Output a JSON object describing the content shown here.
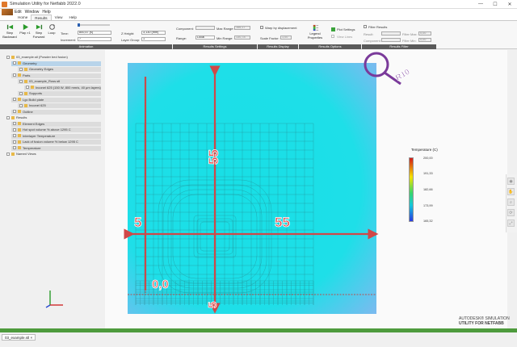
{
  "window": {
    "title": "Simulation Utility for Netfabb 2022.0",
    "controls": [
      "—",
      "☐",
      "✕"
    ]
  },
  "menu": [
    "Edit",
    "Window",
    "Help"
  ],
  "ribbon_tabs": [
    {
      "label": "Home",
      "active": false
    },
    {
      "label": "Results",
      "active": true
    },
    {
      "label": "View",
      "active": false
    },
    {
      "label": "Help",
      "active": false
    }
  ],
  "animation": {
    "step_backward": "Step Backward",
    "play": "Play ×1",
    "step_forward": "Step Forward",
    "loop": "Loop",
    "time_label": "Time:",
    "time_value": "800,57 (s)",
    "increment_label": "Increment:",
    "increment_value": "7",
    "z_height_label": "Z Height:",
    "z_height_value": "3,130 (mm)",
    "layer_group_label": "Layer Group:",
    "layer_group_value": "1",
    "section": "Animation"
  },
  "results_settings": {
    "component_label": "Component:",
    "max_range_label": "Max Range:",
    "max_range_value": "166,17",
    "range_label": "Range:",
    "range_value": "Local",
    "min_range_label": "Min Range:",
    "min_range_value": "130,78",
    "section": "Results Settings"
  },
  "results_display": {
    "warp": "Warp by displacement",
    "scale_label": "Scale Factor:",
    "scale_value": "1,00",
    "section": "Results Display"
  },
  "results_options": {
    "legend": "Legend Properties",
    "plot": "Plot Settings",
    "view_lines": "View Lines",
    "section": "Results Options"
  },
  "results_filter": {
    "filter": "Filter Results",
    "result_label": "Result:",
    "component_label": "Component:",
    "filter_max_label": "Filter Max:",
    "filter_max_value": "0,00",
    "filter_min_label": "Filter Min:",
    "filter_min_value": "0,00",
    "section": "Results Filter"
  },
  "tree": [
    {
      "label": "03_example.stl (Powder bed fusion)",
      "indent": 0,
      "style": "plain"
    },
    {
      "label": "Geometry",
      "indent": 1,
      "style": "sel"
    },
    {
      "label": "Geometry Edges",
      "indent": 2,
      "style": "bar"
    },
    {
      "label": "Parts",
      "indent": 1,
      "style": "bar"
    },
    {
      "label": "03_example_Ross.stl",
      "indent": 2,
      "style": "bar"
    },
    {
      "label": "Inconel 625 (150 W, 800 mm/s, 40 μm layers)",
      "indent": 3,
      "style": "bar"
    },
    {
      "label": "Supports",
      "indent": 2,
      "style": "bar"
    },
    {
      "label": "Lgc Build plate",
      "indent": 1,
      "style": "bar"
    },
    {
      "label": "Inconel 625",
      "indent": 2,
      "style": "bar"
    },
    {
      "label": "Outline",
      "indent": 1,
      "style": "bar"
    },
    {
      "label": "Results",
      "indent": 0,
      "style": "plain"
    },
    {
      "label": "Element Edges",
      "indent": 1,
      "style": "bar"
    },
    {
      "label": "Hot spot volume % above 1295 C",
      "indent": 1,
      "style": "bar"
    },
    {
      "label": "Interlayer Temperature",
      "indent": 1,
      "style": "bar"
    },
    {
      "label": "Lack of fusion volume % below 1295 C",
      "indent": 1,
      "style": "bar"
    },
    {
      "label": "Temperature",
      "indent": 1,
      "style": "bar"
    },
    {
      "label": "Named Views",
      "indent": 0,
      "style": "plain"
    }
  ],
  "annotations": {
    "r10": "R10",
    "v55": "55",
    "h55": "55",
    "left5": "5",
    "origin": "0,0",
    "bottom5": "5"
  },
  "legend": {
    "title": "Temperature (C)",
    "ticks": [
      "200,00",
      "191,33",
      "182,66",
      "173,99",
      "165,32"
    ],
    "colors": {
      "max": "#d21a1a",
      "mid": "#39d66a",
      "min": "#2a3ae0"
    }
  },
  "brand": {
    "line1": "AUTODESK® SIMULATION",
    "line2": "UTILITY FOR NETFABB"
  },
  "doc_tab": "03_example.stl ×"
}
